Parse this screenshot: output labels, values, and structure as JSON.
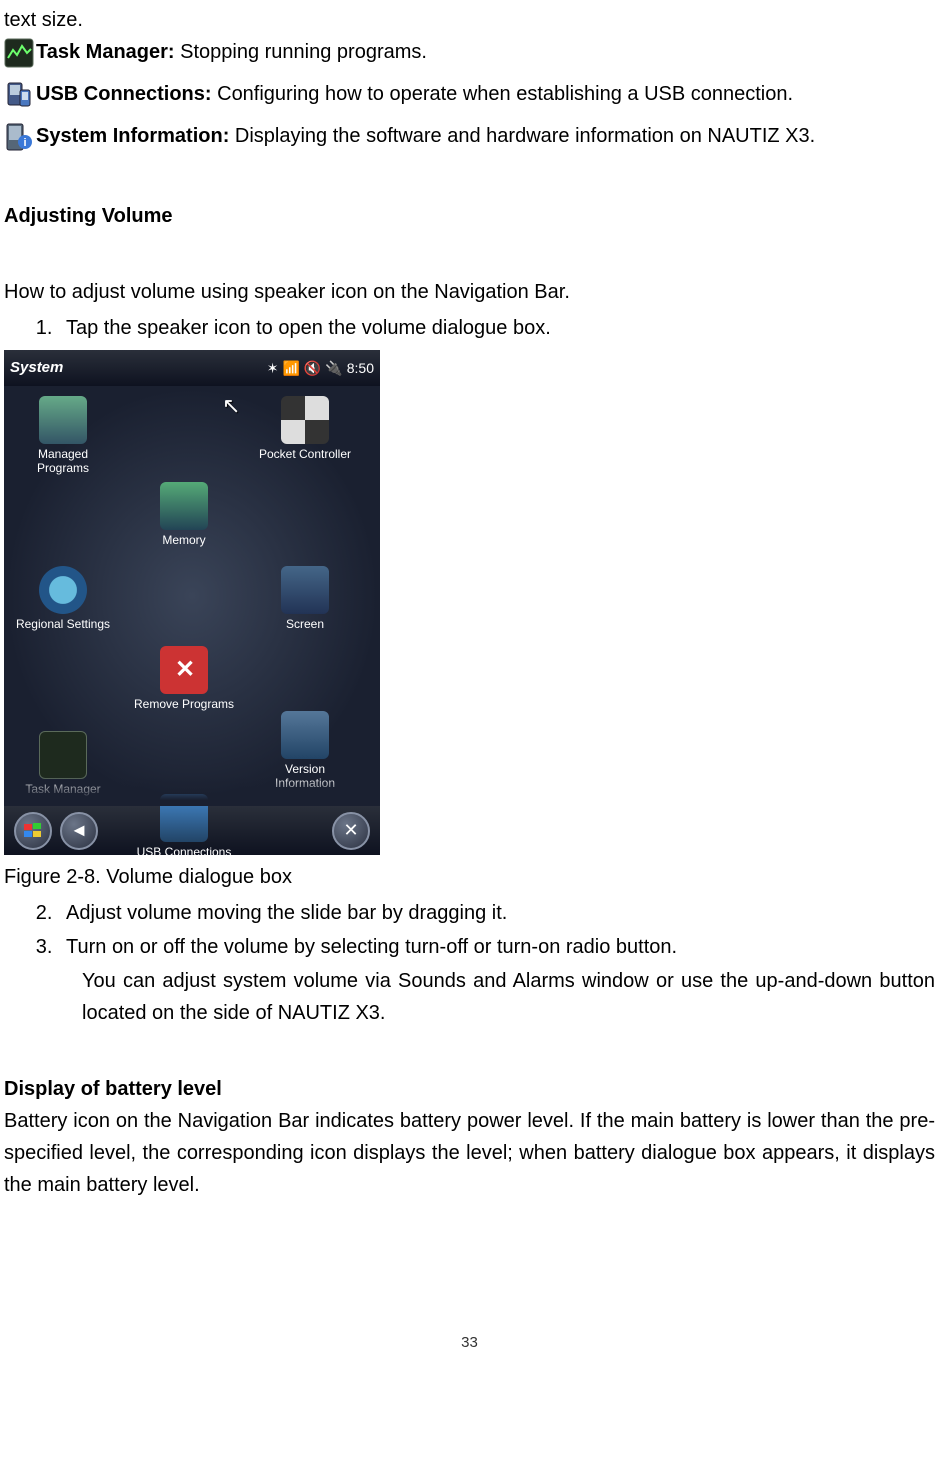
{
  "intro_fragment": "text size.",
  "defs": {
    "task_manager_label": "Task Manager:",
    "task_manager_desc": " Stopping running programs.",
    "usb_label": "USB Connections:",
    "usb_desc": " Configuring how to operate when establishing a USB connection.",
    "sysinfo_label": "System Information:",
    "sysinfo_desc": " Displaying the software and hardware information on NAUTIZ X3."
  },
  "adjusting_volume_heading": "Adjusting Volume",
  "volume_intro": "How to adjust volume using speaker icon on the Navigation Bar.",
  "volume_steps": {
    "s1": "Tap the speaker icon to open the volume dialogue box.",
    "s2": "Adjust volume moving the slide bar by dragging it.",
    "s3": "Turn on or off the volume by selecting turn-off or turn-on radio button."
  },
  "figure_caption": "Figure 2-8. Volume dialogue box",
  "volume_note": "You can adjust system volume via Sounds and Alarms window or use the up-and-down button located on the side of NAUTIZ X3.",
  "battery_heading": "Display of battery level",
  "battery_para": "Battery icon on the Navigation Bar indicates battery power level. If the main battery is lower than the pre-specified level, the corresponding icon displays the level; when battery dialogue box appears, it displays the main battery level.",
  "page_number": "33",
  "screenshot": {
    "title": "System",
    "status_icons": [
      "✶",
      "📶",
      "🔇",
      "🔌"
    ],
    "time": "8:50",
    "apps": {
      "managed_programs": "Managed\nPrograms",
      "pocket_controller": "Pocket Controller",
      "memory": "Memory",
      "regional_settings": "Regional Settings",
      "screen": "Screen",
      "remove_programs": "Remove Programs",
      "task_manager": "Task Manager",
      "version_information": "Version\nInformation",
      "usb_connections": "USB Connections"
    }
  }
}
